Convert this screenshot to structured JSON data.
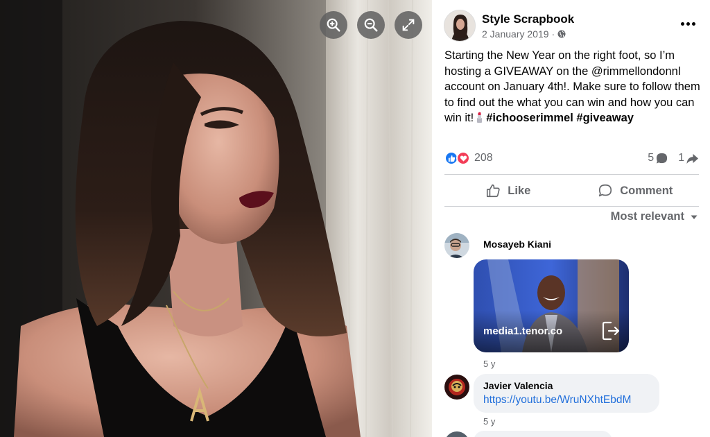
{
  "viewer": {
    "controls": [
      "zoom-in",
      "zoom-out",
      "fullscreen"
    ]
  },
  "post": {
    "page_name": "Style Scrapbook",
    "date": "2 January 2019",
    "date_separator": "·",
    "privacy_icon": "globe-icon",
    "text_main": "Starting the New Year on the right foot, so I’m hosting a GIVEAWAY on the @rimmellondonnl account on January 4th!. Make sure to follow them to find out the what you can win and how you can win it!",
    "hashtags": [
      "#ichooserimmel",
      "#giveaway"
    ],
    "emoji": "lipstick-emoji"
  },
  "stats": {
    "reaction_icons": [
      "like-icon",
      "love-icon"
    ],
    "reactions": "208",
    "comments": "5",
    "shares": "1"
  },
  "actions": {
    "like": "Like",
    "comment": "Comment"
  },
  "sort": {
    "label": "Most relevant"
  },
  "comments": [
    {
      "author": "Mosayeb Kiani",
      "attachment": {
        "type": "gif",
        "domain": "media1.tenor.co"
      },
      "time": "5 y"
    },
    {
      "author": "Javier Valencia",
      "link": "https://youtu.be/WruNXhtEbdM",
      "time": "5 y"
    }
  ],
  "colors": {
    "like_blue": "#1877f2",
    "love_red": "#f33e58",
    "link_blue": "#216fdb",
    "secondary_text": "#65676b",
    "divider": "#ced0d4",
    "bubble_bg": "#f0f2f5"
  }
}
